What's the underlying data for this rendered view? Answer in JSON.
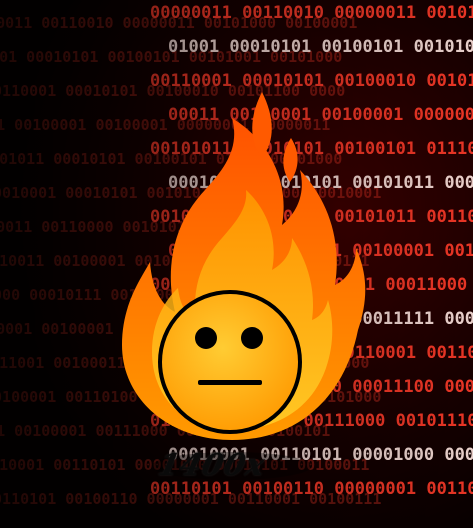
{
  "image": {
    "wordmark_text": "1400x",
    "binary_rows": [
      "00000011 00110010 00000011 00101000 00100001",
      "01001 00010101 00100101 00101001 00101000",
      "00110001 00010101 00100010 00101100 0000",
      "00011 00100001 00100001 00000001 00000011",
      "00101011 00010101 00100101 01110000 01000",
      "00010001 00010101 00101011 00010000 00010001",
      "00100011 00110000 00101011 00110001 00010",
      "00010011 00100001 00100001 00111000 00010111",
      "0000 00010111 00110001 00011000 00110001",
      "00110001 00100001 00011111 00010000 00001",
      "00011001 00100011 00110001 00110101 00011000",
      "00100001 00110100 00011100 00000010 00101000",
      "01101 00100001 00111000 00101110 00100101",
      "00010001 00110101 00001000 00010101 00100011",
      "00110101 00100110 00000001 00110001 00100111"
    ]
  },
  "colors": {
    "background": "#050000",
    "binary_bright": "#ff3b2a",
    "binary_white": "#ffe6e0",
    "flame_outer": "#ff6a00",
    "flame_inner": "#ffc21a",
    "face": "#ffb000",
    "face_outline": "#000000"
  },
  "icons": {
    "logo": "fire-emoji-neutral-face-icon"
  }
}
